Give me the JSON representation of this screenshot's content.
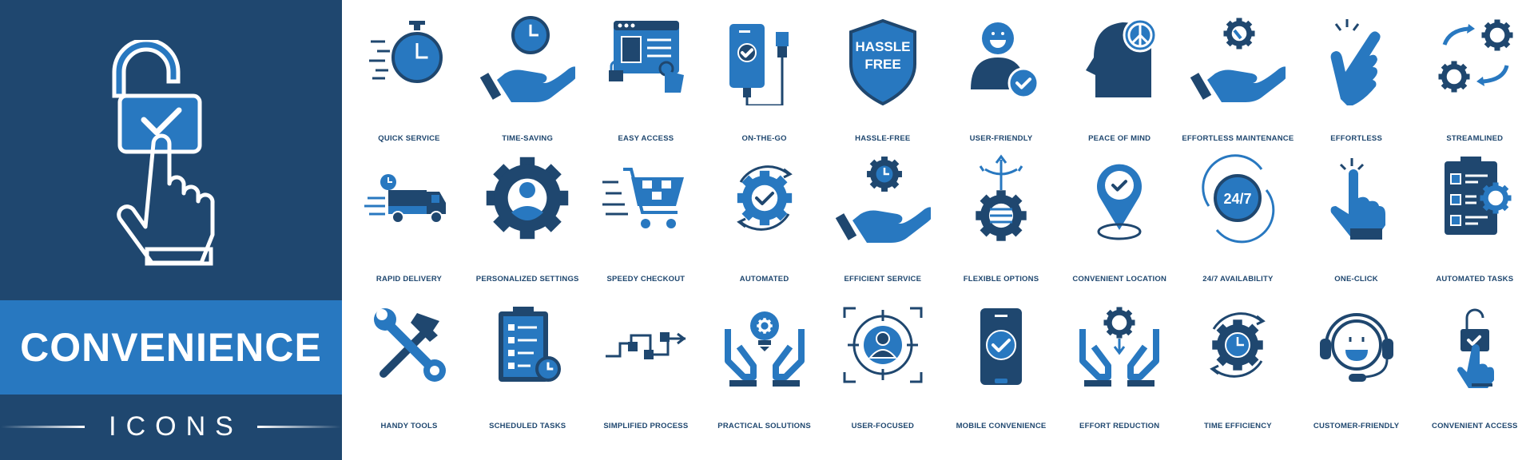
{
  "colors": {
    "navy": "#1f476f",
    "blue": "#2878c0",
    "white": "#ffffff"
  },
  "banner": {
    "title": "CONVENIENCE",
    "subtitle": "ICONS",
    "hero_icon": "unlock-touch-icon"
  },
  "icons": [
    {
      "label": "QUICK SERVICE",
      "icon": "stopwatch-icon"
    },
    {
      "label": "TIME-SAVING",
      "icon": "hand-clock-icon"
    },
    {
      "label": "EASY ACCESS",
      "icon": "browser-lock-icon"
    },
    {
      "label": "ON-THE-GO",
      "icon": "phone-charger-icon"
    },
    {
      "label": "HASSLE-FREE",
      "icon": "shield-icon",
      "badge_line1": "HASSLE",
      "badge_line2": "FREE"
    },
    {
      "label": "USER-FRIENDLY",
      "icon": "user-check-icon"
    },
    {
      "label": "PEACE OF MIND",
      "icon": "head-peace-icon"
    },
    {
      "label": "EFFORTLESS MAINTENANCE",
      "icon": "hand-gear-wrench-icon"
    },
    {
      "label": "EFFORTLESS",
      "icon": "swipe-hand-icon"
    },
    {
      "label": "STREAMLINED",
      "icon": "gears-arrows-icon"
    },
    {
      "label": "RAPID DELIVERY",
      "icon": "truck-icon"
    },
    {
      "label": "PERSONALIZED SETTINGS",
      "icon": "gear-user-icon"
    },
    {
      "label": "SPEEDY CHECKOUT",
      "icon": "cart-icon"
    },
    {
      "label": "AUTOMATED",
      "icon": "gear-cycle-icon"
    },
    {
      "label": "EFFICIENT SERVICE",
      "icon": "hand-gear-clock-icon"
    },
    {
      "label": "FLEXIBLE OPTIONS",
      "icon": "gear-options-icon"
    },
    {
      "label": "CONVENIENT LOCATION",
      "icon": "location-pin-icon"
    },
    {
      "label": "24/7 AVAILABILITY",
      "icon": "clock-247-icon",
      "badge_text": "24/7"
    },
    {
      "label": "ONE-CLICK",
      "icon": "tap-hand-icon"
    },
    {
      "label": "AUTOMATED TASKS",
      "icon": "clipboard-gear-icon"
    },
    {
      "label": "HANDY TOOLS",
      "icon": "wrench-hammer-icon"
    },
    {
      "label": "SCHEDULED TASKS",
      "icon": "clipboard-clock-icon"
    },
    {
      "label": "SIMPLIFIED PROCESS",
      "icon": "process-flow-icon"
    },
    {
      "label": "PRACTICAL SOLUTIONS",
      "icon": "hands-bulb-icon"
    },
    {
      "label": "USER-FOCUSED",
      "icon": "target-user-icon"
    },
    {
      "label": "MOBILE CONVENIENCE",
      "icon": "mobile-check-icon"
    },
    {
      "label": "EFFORT REDUCTION",
      "icon": "hands-gear-icon"
    },
    {
      "label": "TIME EFFICIENCY",
      "icon": "gear-clock-cycle-icon"
    },
    {
      "label": "CUSTOMER-FRIENDLY",
      "icon": "headset-smile-icon"
    },
    {
      "label": "CONVENIENT ACCESS",
      "icon": "unlock-tap-icon"
    }
  ]
}
